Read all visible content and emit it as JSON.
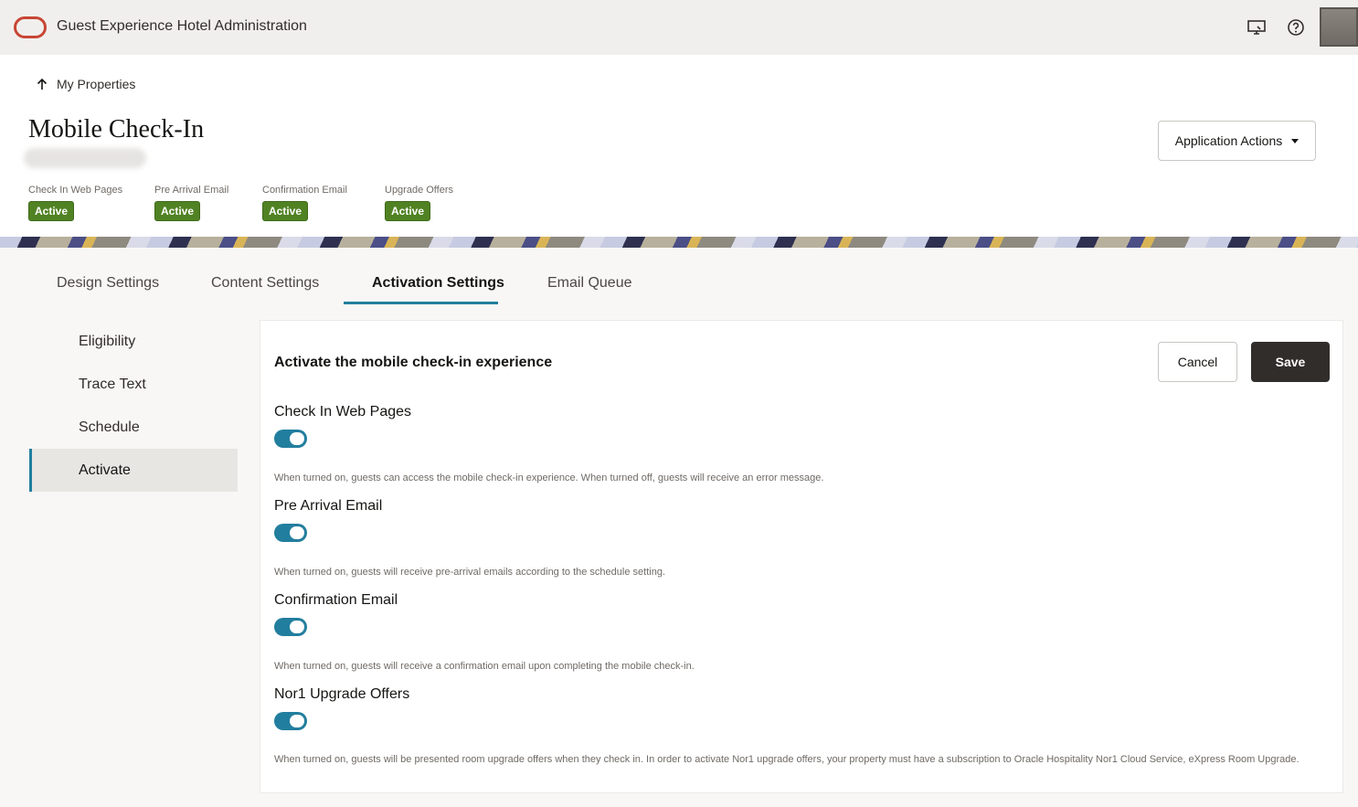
{
  "app": {
    "title": "Guest Experience Hotel Administration"
  },
  "header": {
    "icons": {
      "screen": "screen-share-icon",
      "help": "help-icon"
    }
  },
  "breadcrumb": {
    "back_label": "My Properties"
  },
  "page": {
    "title": "Mobile Check-In"
  },
  "actions": {
    "application_actions_label": "Application Actions"
  },
  "statuses": [
    {
      "label": "Check In Web Pages",
      "value": "Active"
    },
    {
      "label": "Pre Arrival Email",
      "value": "Active"
    },
    {
      "label": "Confirmation Email",
      "value": "Active"
    },
    {
      "label": "Upgrade Offers",
      "value": "Active"
    }
  ],
  "tabs": [
    {
      "label": "Design Settings",
      "active": false
    },
    {
      "label": "Content Settings",
      "active": false
    },
    {
      "label": "Activation Settings",
      "active": true
    },
    {
      "label": "Email Queue",
      "active": false
    }
  ],
  "sidenav": [
    {
      "label": "Eligibility",
      "active": false
    },
    {
      "label": "Trace Text",
      "active": false
    },
    {
      "label": "Schedule",
      "active": false
    },
    {
      "label": "Activate",
      "active": true
    }
  ],
  "panel": {
    "title": "Activate the mobile check-in experience",
    "cancel_label": "Cancel",
    "save_label": "Save",
    "settings": [
      {
        "label": "Check In Web Pages",
        "enabled": true,
        "help": "When turned on, guests can access the mobile check-in experience. When turned off, guests will receive an error message."
      },
      {
        "label": "Pre Arrival Email",
        "enabled": true,
        "help": "When turned on, guests will receive pre-arrival emails according to the schedule setting."
      },
      {
        "label": "Confirmation Email",
        "enabled": true,
        "help": "When turned on, guests will receive a confirmation email upon completing the mobile check-in."
      },
      {
        "label": "Nor1 Upgrade Offers",
        "enabled": true,
        "help": "When turned on, guests will be presented room upgrade offers when they check in. In order to activate Nor1 upgrade offers, your property must have a subscription to Oracle Hospitality Nor1 Cloud Service, eXpress Room Upgrade."
      }
    ]
  },
  "colors": {
    "accent": "#227e9e",
    "badge": "#508223",
    "brand": "#c74634",
    "save": "#312d2a"
  }
}
